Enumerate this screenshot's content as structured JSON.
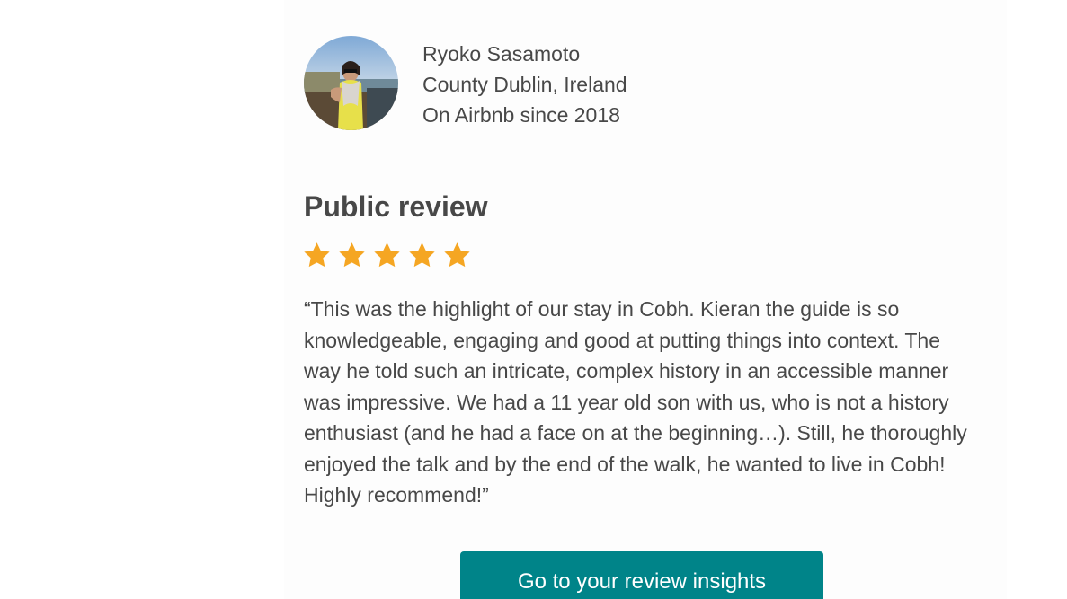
{
  "reviewer": {
    "name": "Ryoko Sasamoto",
    "location": "County Dublin, Ireland",
    "member_since": "On Airbnb since 2018"
  },
  "review": {
    "section_title": "Public review",
    "rating": 5,
    "rating_max": 5,
    "star_color": "#F5A623",
    "text": "“This was the highlight of our stay in Cobh. Kieran the guide is so knowledgeable, engaging and good at putting things into context. The way he told such an intricate, complex history in an accessible manner was impressive. We had a 11 year old son with us, who is not a history enthusiast (and he had a face on at the beginning…). Still, he thoroughly enjoyed the talk and by the end of the walk, he wanted to live in Cobh! Highly recommend!”"
  },
  "actions": {
    "insights_label": "Go to your review insights",
    "button_color": "#008489"
  }
}
